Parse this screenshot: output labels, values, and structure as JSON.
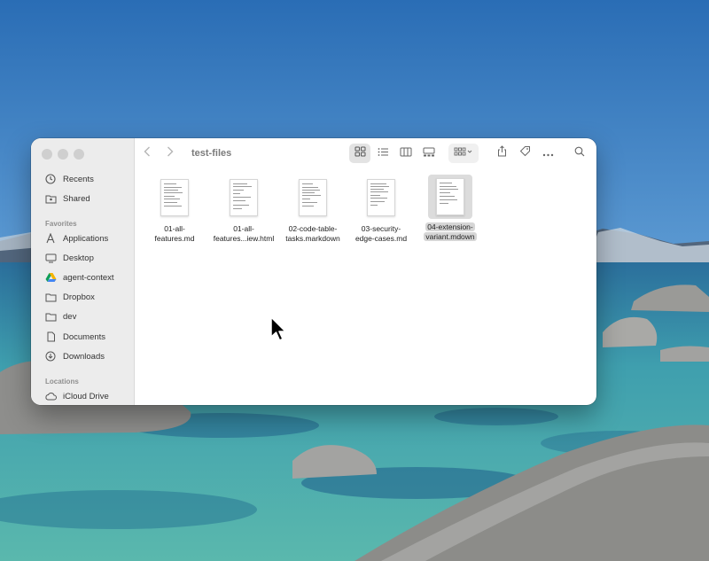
{
  "window": {
    "title": "test-files"
  },
  "sidebar": {
    "top_items": [
      {
        "label": "Recents",
        "icon": "clock-icon"
      },
      {
        "label": "Shared",
        "icon": "shared-folder-icon"
      }
    ],
    "favorites_header": "Favorites",
    "favorites": [
      {
        "label": "Applications",
        "icon": "applications-icon"
      },
      {
        "label": "Desktop",
        "icon": "desktop-icon"
      },
      {
        "label": "agent-context",
        "icon": "google-drive-icon"
      },
      {
        "label": "Dropbox",
        "icon": "folder-icon"
      },
      {
        "label": "dev",
        "icon": "folder-icon"
      },
      {
        "label": "Documents",
        "icon": "document-icon"
      },
      {
        "label": "Downloads",
        "icon": "download-icon"
      }
    ],
    "locations_header": "Locations",
    "locations": [
      {
        "label": "iCloud Drive",
        "icon": "cloud-icon"
      }
    ]
  },
  "files": [
    {
      "line1": "01-all-",
      "line2": "features.md",
      "selected": false
    },
    {
      "line1": "01-all-",
      "line2": "features...iew.html",
      "selected": false
    },
    {
      "line1": "02-code-table-",
      "line2": "tasks.markdown",
      "selected": false
    },
    {
      "line1": "03-security-",
      "line2": "edge-cases.md",
      "selected": false
    },
    {
      "line1": "04-extension-",
      "line2": "variant.mdown",
      "selected": true
    }
  ],
  "toolbar": {
    "back_icon": "chevron-left-icon",
    "forward_icon": "chevron-right-icon",
    "view_modes": [
      "icon-view-icon",
      "list-view-icon",
      "column-view-icon",
      "gallery-view-icon"
    ],
    "active_view": "icon-view-icon",
    "group_icon": "group-by-icon",
    "share_icon": "share-icon",
    "tag_icon": "tag-icon",
    "more_icon": "more-icon",
    "search_icon": "search-icon"
  },
  "colors": {
    "sky_top": "#2a6db5",
    "sky_bottom": "#5d9bd3",
    "water_shallow": "#4fb0b0",
    "water_deep": "#1d5d8a",
    "mountains": "#5a6d84",
    "sidebar_bg": "#ececec",
    "window_bg": "#ffffff"
  }
}
